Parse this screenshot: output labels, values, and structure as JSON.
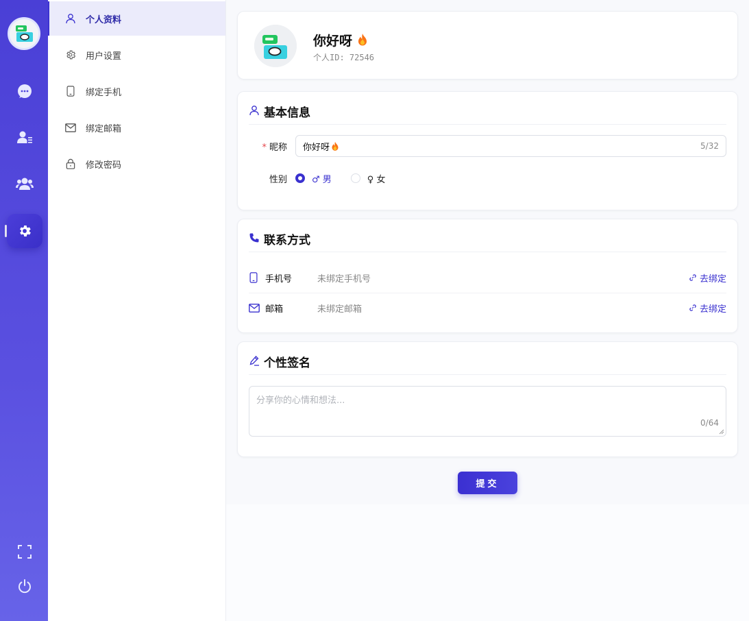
{
  "rail": {
    "icons": [
      "chat-icon",
      "contacts-icon",
      "group-icon",
      "settings-icon",
      "fullscreen-icon",
      "power-icon"
    ],
    "active": "settings-icon"
  },
  "submenu": {
    "items": [
      {
        "label": "个人资料",
        "icon": "user-icon",
        "active": true
      },
      {
        "label": "用户设置",
        "icon": "gear-icon",
        "active": false
      },
      {
        "label": "绑定手机",
        "icon": "phone-icon",
        "active": false
      },
      {
        "label": "绑定邮箱",
        "icon": "mail-icon",
        "active": false
      },
      {
        "label": "修改密码",
        "icon": "lock-icon",
        "active": false
      }
    ]
  },
  "profile": {
    "name": "你好呀",
    "id_text": "个人ID: 72546"
  },
  "basic": {
    "title": "基本信息",
    "nickname_label": "昵称",
    "nickname_value": "你好呀",
    "nickname_count": "5/32",
    "gender_label": "性别",
    "male": "♂ 男",
    "female": "♀ 女",
    "gender_selected": "male"
  },
  "contact": {
    "title": "联系方式",
    "phone_label": "手机号",
    "phone_value": "未绑定手机号",
    "phone_action": "去绑定",
    "email_label": "邮箱",
    "email_value": "未绑定邮箱",
    "email_action": "去绑定"
  },
  "signature": {
    "title": "个性签名",
    "placeholder": "分享你的心情和想法...",
    "count": "0/64"
  },
  "submit_label": "提交",
  "colors": {
    "accent": "#3a31cf",
    "rail": "#4a3fd6",
    "active_bg": "#ebebfb"
  }
}
